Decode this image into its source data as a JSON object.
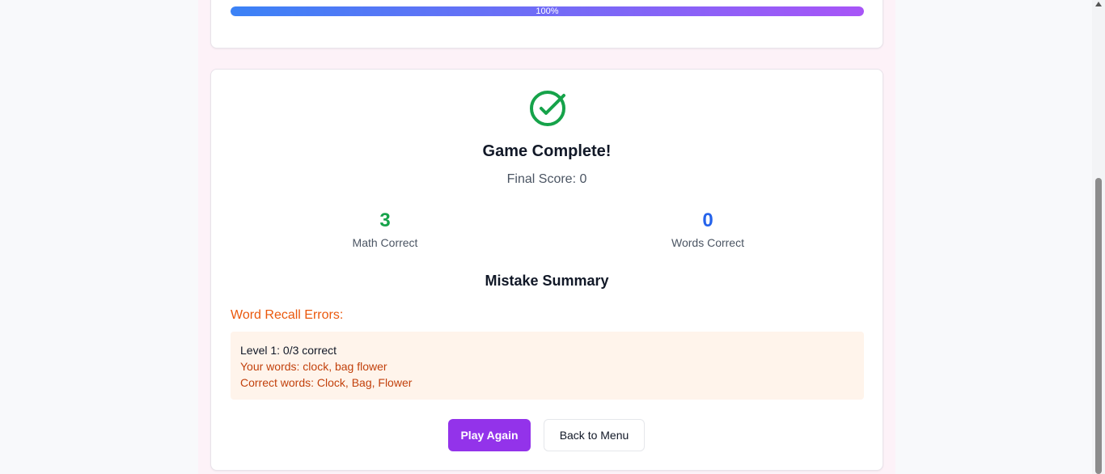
{
  "progress": {
    "label": "100%",
    "value": 1.0
  },
  "result": {
    "title": "Game Complete!",
    "final_score_label": "Final Score: 0"
  },
  "stats": {
    "math": {
      "value": "3",
      "label": "Math Correct"
    },
    "words": {
      "value": "0",
      "label": "Words Correct"
    }
  },
  "mistakes": {
    "title": "Mistake Summary",
    "word_errors_heading": "Word Recall Errors:",
    "items": [
      {
        "level": "Level 1: 0/3 correct",
        "your_words": "Your words: clock, bag flower",
        "correct_words": "Correct words: Clock, Bag, Flower"
      }
    ]
  },
  "buttons": {
    "play_again": "Play Again",
    "back_to_menu": "Back to Menu"
  },
  "colors": {
    "accent": "#9333ea",
    "success": "#16a34a",
    "info": "#2563eb",
    "warning": "#ea580c"
  },
  "icons": {
    "result": "check-circle-icon"
  }
}
